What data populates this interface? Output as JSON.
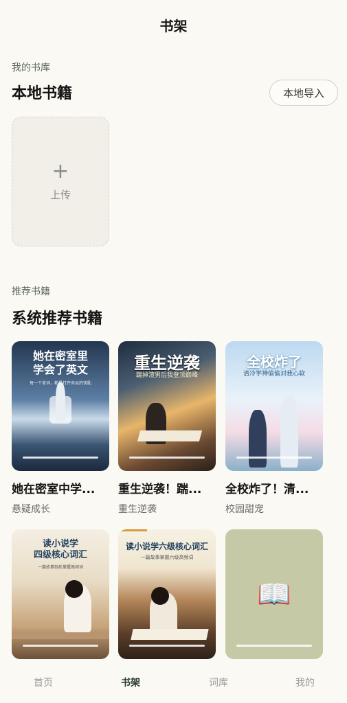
{
  "header": {
    "title": "书架"
  },
  "library": {
    "subtitle": "我的书库",
    "title": "本地书籍",
    "import_label": "本地导入",
    "upload_label": "上传"
  },
  "recommend": {
    "subtitle": "推荐书籍",
    "title": "系统推荐书籍",
    "books": [
      {
        "name": "她在密室中学...",
        "tag": "悬疑成长",
        "cover_title": "她在密室里学会了英文",
        "cover_title_l1": "她在密室里",
        "cover_title_l2": "学会了英文",
        "cover_sub": "每一个单词，都是打开命运的钥匙"
      },
      {
        "name": "重生逆袭！踹...",
        "tag": "重生逆袭",
        "cover_title": "重生逆袭",
        "cover_sub": "踹掉渣男后我登顶巅峰"
      },
      {
        "name": "全校炸了！清...",
        "tag": "校园甜宠",
        "cover_title": "全校炸了",
        "cover_sub": "清冷学神偷偷对我心软"
      },
      {
        "name": "",
        "tag": "",
        "cover_title_l1": "读小说学",
        "cover_title_l2": "四级核心词汇",
        "cover_sub": "一篇故事轻松掌握高频词"
      },
      {
        "name": "",
        "tag": "",
        "cover_title": "读小说学六级核心词汇",
        "cover_sub": "一篇故事掌握六级高频词"
      },
      {
        "name": "",
        "tag": "",
        "cover_icon": "open-book-icon"
      }
    ]
  },
  "tabs": [
    {
      "label": "首页",
      "active": false
    },
    {
      "label": "书架",
      "active": true
    },
    {
      "label": "词库",
      "active": false
    },
    {
      "label": "我的",
      "active": false
    }
  ],
  "colors": {
    "background": "#fbf9f3",
    "accent": "#2c3a2f",
    "muted": "#9b9b9b"
  }
}
